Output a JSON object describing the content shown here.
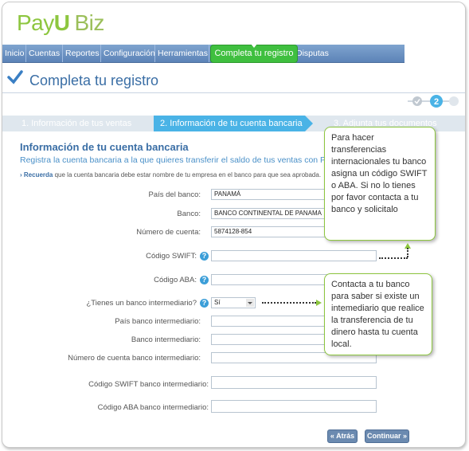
{
  "brand": {
    "name_part1": "Pay",
    "name_part2": "U",
    "name_part3": "Biz"
  },
  "nav": {
    "items": [
      "Inicio",
      "Cuentas",
      "Reportes",
      "Configuración",
      "Herramientas",
      "",
      "Disputas"
    ],
    "active_label": "Completa tu registro"
  },
  "page": {
    "title": "Completa tu registro",
    "current_step_number": "2"
  },
  "steps": [
    "1. Información de tus ventas",
    "2. Información de tu cuenta bancaria",
    "3. Adjunta tus documentos"
  ],
  "section": {
    "title": "Información de tu cuenta bancaria",
    "subtitle": "Registra la cuenta bancaria a la que quieres transferir el saldo de tus ventas con PayU.",
    "reminder_bold": "Recuerda",
    "reminder_text": " que la cuenta bancaria debe estar nombre de tu empresa en el banco para que sea aprobada."
  },
  "form": {
    "pais_label": "País del banco:",
    "pais_value": "PANAMÁ",
    "banco_label": "Banco:",
    "banco_value": "BANCO CONTINENTAL DE PANAMA",
    "numero_label": "Número de cuenta:",
    "numero_value": "5874128-854",
    "swift_label": "Código SWIFT:",
    "aba_label": "Código ABA:",
    "intermediario_label": "¿Tienes un banco intermediario?",
    "intermediario_value": "Sí",
    "pais_inter_label": "País banco intermediario:",
    "banco_inter_label": "Banco intermediario:",
    "numero_inter_label": "Número de cuenta banco intermediario:",
    "swift_inter_label": "Código SWIFT banco intermediario:",
    "aba_inter_label": "Código ABA banco intermediario:"
  },
  "buttons": {
    "back": "« Atrás",
    "next": "Continuar »"
  },
  "tooltips": {
    "swift_aba": "Para hacer transferencias internacionales tu banco asigna un código SWIFT o ABA. Si no lo tienes por favor contacta a tu banco y solicitalo",
    "intermediario": "Contacta a tu banco para saber si existe un intemediario que realice la transferencia de tu dinero hasta tu cuenta local."
  },
  "colors": {
    "brand_green": "#8dc63f",
    "nav_blue": "#6b90c0",
    "active_step": "#4ab3e6",
    "title_blue": "#3a6ea5"
  }
}
